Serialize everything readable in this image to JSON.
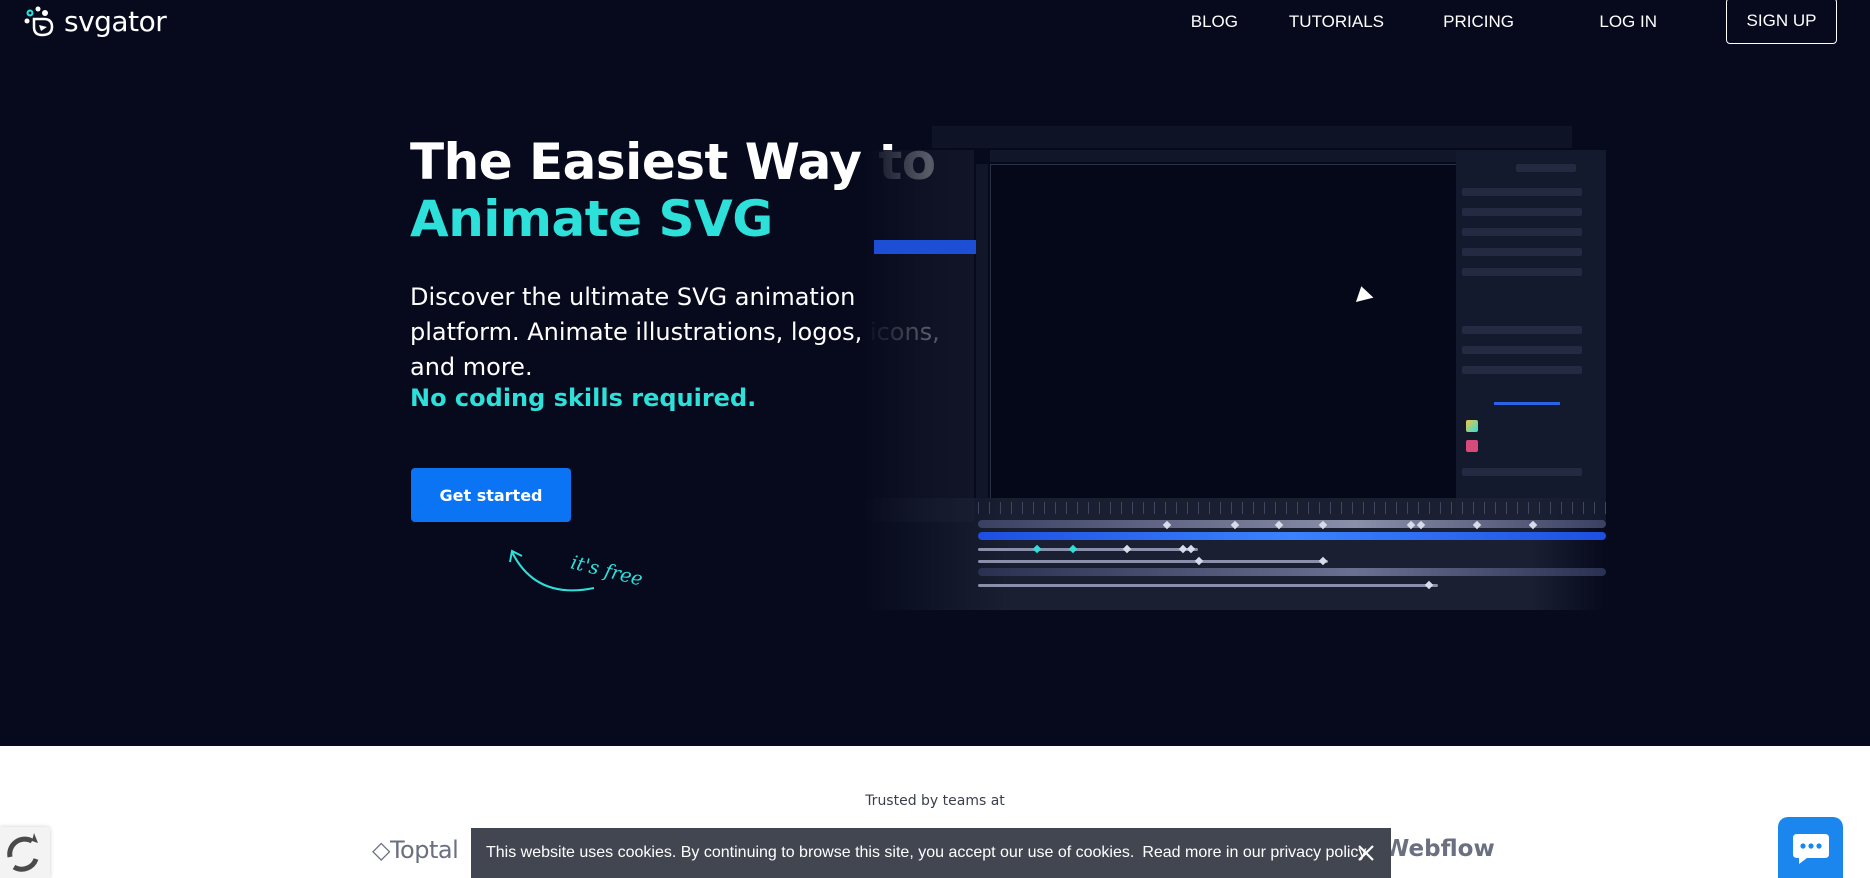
{
  "brand": {
    "name": "svgator",
    "accent": "#2de0da",
    "primary_button": "#0a74f5",
    "hero_background": "#060a1c"
  },
  "nav": {
    "items": [
      {
        "label": "BLOG"
      },
      {
        "label": "TUTORIALS"
      },
      {
        "label": "PRICING"
      },
      {
        "label": "LOG IN"
      }
    ],
    "signup_label": "SIGN UP"
  },
  "hero": {
    "headline_line1": "The Easiest Way to",
    "headline_line2": "Animate SVG",
    "description": "Discover the ultimate SVG animation platform. Animate illustrations, logos, icons, and more.",
    "highlight": "No coding skills required.",
    "cta_label": "Get started",
    "free_note": "it's free"
  },
  "trusted": {
    "heading": "Trusted by teams at",
    "logos": [
      {
        "name": "Toptal"
      },
      {
        "name": "Webflow"
      }
    ]
  },
  "cookie_banner": {
    "text": "This website uses cookies. By continuing to browse this site, you accept our use of cookies.",
    "link_label": "Read more in our privacy policy"
  }
}
